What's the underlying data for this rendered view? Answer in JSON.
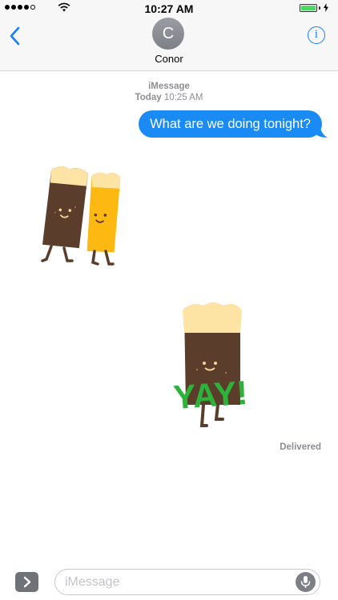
{
  "status_bar": {
    "time": "10:27 AM",
    "signal_dots_filled": 4,
    "signal_dots_total": 5,
    "battery_level_fraction": 1.0,
    "charging": true,
    "battery_color": "#4cd964"
  },
  "nav": {
    "back_icon": "chevron-left-icon",
    "avatar_initial": "C",
    "contact_name": "Conor",
    "info_icon": "info-icon",
    "accent_color": "#157efb"
  },
  "conversation": {
    "service_label": "iMessage",
    "timestamp_day": "Today",
    "timestamp_time": "10:25 AM",
    "messages": [
      {
        "text": "What are we doing tonight?",
        "sender": "me",
        "bubble_color": "#1a8bf5"
      }
    ],
    "stickers": [
      {
        "name": "cheers-beer-sticker"
      },
      {
        "name": "yay-beer-sticker",
        "text": "YAY!"
      }
    ],
    "delivered_label": "Delivered"
  },
  "input_bar": {
    "placeholder": "iMessage",
    "apps_icon": "chevron-right-icon",
    "mic_icon": "microphone-icon"
  }
}
